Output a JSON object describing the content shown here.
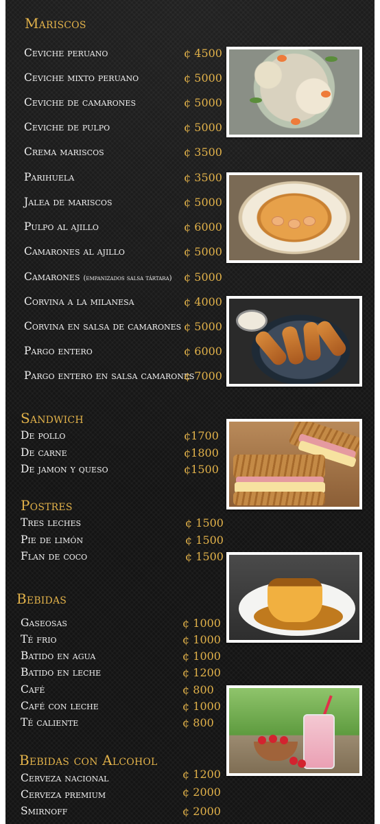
{
  "sections": {
    "mariscos": {
      "title": "Mariscos",
      "items": [
        {
          "name": "Ceviche peruano",
          "price": "¢ 4500"
        },
        {
          "name": "Ceviche mixto peruano",
          "price": "¢ 5000"
        },
        {
          "name": "Ceviche de camarones",
          "price": "¢ 5000"
        },
        {
          "name": "Ceviche de pulpo",
          "price": "¢ 5000"
        },
        {
          "name": "Crema mariscos",
          "price": "¢ 3500"
        },
        {
          "name": "Parihuela",
          "price": "¢ 3500"
        },
        {
          "name": "Jalea de mariscos",
          "price": "¢ 5000"
        },
        {
          "name": "Pulpo al ajillo",
          "price": "¢ 6000"
        },
        {
          "name": "Camarones al ajillo",
          "price": "¢ 5000"
        },
        {
          "name": "Camarones",
          "note": "(empanizados salsa tártara)",
          "price": "¢ 5000"
        },
        {
          "name": "Corvina a la milanesa",
          "price": "¢ 4000"
        },
        {
          "name": "Corvina en salsa de camarones",
          "price": "¢ 5000"
        },
        {
          "name": "Pargo entero",
          "price": "¢ 6000"
        },
        {
          "name": "Pargo entero en salsa camarones",
          "price": "¢ 7000"
        }
      ]
    },
    "sandwich": {
      "title": "Sandwich",
      "items": [
        {
          "name": "De pollo",
          "price": "¢1700"
        },
        {
          "name": "De carne",
          "price": "¢1800"
        },
        {
          "name": "De jamon y queso",
          "price": "¢1500"
        }
      ]
    },
    "postres": {
      "title": "Postres",
      "items": [
        {
          "name": "Tres leches",
          "price": "¢ 1500"
        },
        {
          "name": "Pie de limón",
          "price": "¢ 1500"
        },
        {
          "name": "Flan de coco",
          "price": "¢ 1500"
        }
      ]
    },
    "bebidas": {
      "title": "Bebidas",
      "items": [
        {
          "name": "Gaseosas",
          "price": "¢ 1000"
        },
        {
          "name": "Té frio",
          "price": "¢ 1000"
        },
        {
          "name": "Batido en agua",
          "price": "¢ 1000"
        },
        {
          "name": "Batido en leche",
          "price": "¢ 1200"
        },
        {
          "name": "Café",
          "price": "¢ 800"
        },
        {
          "name": "Café con leche",
          "price": "¢ 1000"
        },
        {
          "name": "Té caliente",
          "price": "¢ 800"
        }
      ]
    },
    "bebidas_alcohol": {
      "title": "Bebidas con Alcohol",
      "items": [
        {
          "name": "Cerveza nacional",
          "price": "¢ 1200"
        },
        {
          "name": "Cerveza premium",
          "price": "¢ 2000"
        },
        {
          "name": "Smirnoff",
          "price": "¢ 2000"
        }
      ]
    }
  },
  "photos": [
    "ceviche-photo",
    "soup-photo",
    "fried-shrimp-photo",
    "sandwich-photo",
    "flan-photo",
    "smoothie-photo"
  ],
  "colors": {
    "accent": "#e2b24a",
    "text": "#f2f2f2",
    "background": "#141414"
  }
}
